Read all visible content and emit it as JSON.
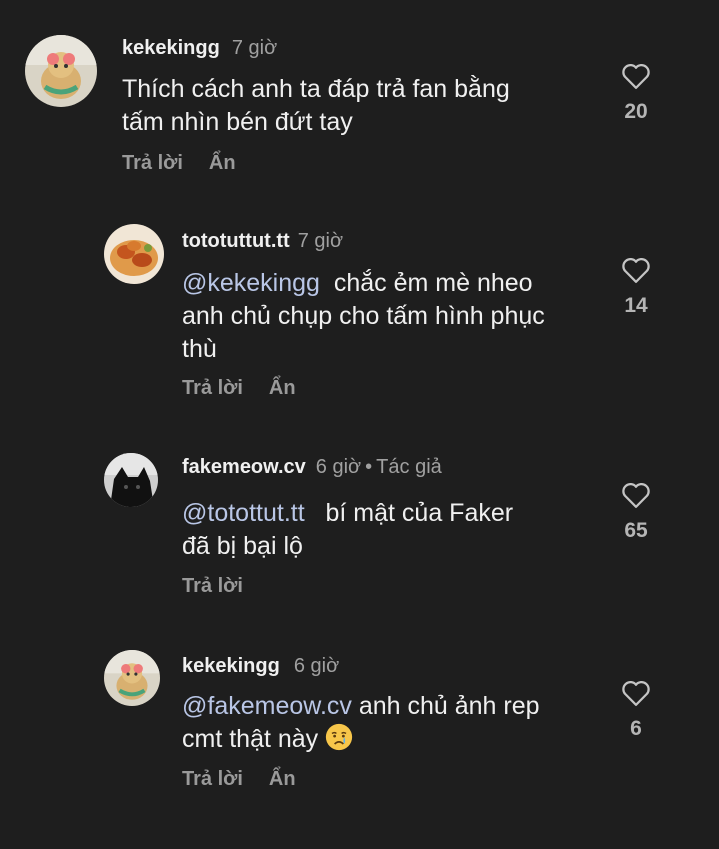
{
  "comments": [
    {
      "username": "kekekingg",
      "time": "7 giờ",
      "text_lines": [
        "Thích cách anh ta đáp trả fan bằng",
        "tấm nhìn bén đứt tay"
      ],
      "likes": "20",
      "reply_label": "Trả lời",
      "hide_label": "Ẩn",
      "avatar_icon": "cat-toy-avatar"
    },
    {
      "username": "tototuttut.tt",
      "time": "7 giờ",
      "mention": "@kekekingg",
      "text_first": "chắc ẻm mè nheo",
      "text_lines": [
        "anh chủ chụp cho tấm hình phục",
        "thù"
      ],
      "likes": "14",
      "reply_label": "Trả lời",
      "hide_label": "Ẩn",
      "avatar_icon": "food-avatar"
    },
    {
      "username": "fakemeow.cv",
      "time": "6 giờ",
      "author_tag": "Tác giả",
      "mention": "@totottut.tt",
      "text_first": "bí mật của Faker",
      "text_lines": [
        "đã bị bại lộ"
      ],
      "likes": "65",
      "reply_label": "Trả lời",
      "avatar_icon": "black-cat-avatar"
    },
    {
      "username": "kekekingg",
      "time": "6 giờ",
      "mention": "@fakemeow.cv",
      "text_first": "anh chủ ảnh rep",
      "text_second": "cmt thật này",
      "emoji": "crying-face-emoji",
      "likes": "6",
      "reply_label": "Trả lời",
      "hide_label": "Ẩn",
      "avatar_icon": "cat-toy-avatar"
    }
  ],
  "colors": {
    "background": "#1e1e1e",
    "text": "#f0f0f0",
    "muted": "#a0a0a0",
    "mention": "#b9c6e6"
  }
}
